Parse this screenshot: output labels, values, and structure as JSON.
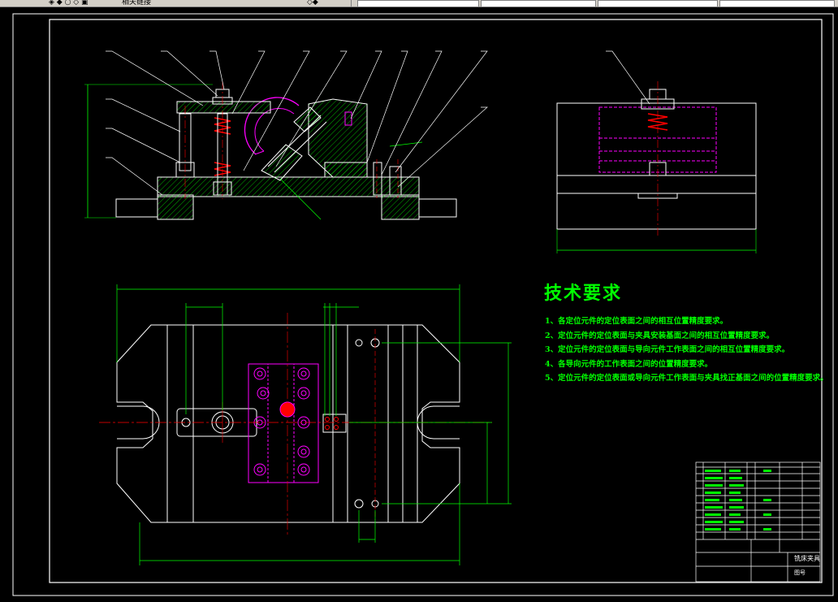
{
  "toolbar": {
    "visible_label": "相关链接"
  },
  "drawing": {
    "title": "技术要求",
    "requirements": [
      "1、各定位元件的定位表面之间的相互位置精度要求。",
      "2、定位元件的定位表面与夹具安装基面之间的相互位置精度要求。",
      "3、定位元件的定位表面与导向元件工作表面之间的相互位置精度要求。",
      "4、各导向元件的工作表面之间的位置精度要求。",
      "5、定位元件的定位表面或导向元件工作表面与夹具找正基面之间的位置精度要求。"
    ],
    "title_block": {
      "name": "铣床夹具",
      "drawing_no": "图号"
    }
  },
  "colors": {
    "background": "#000000",
    "border": "#ffffff",
    "dimension": "#00ff00",
    "hatch": "#00ff00",
    "part_outline": "#ffffff",
    "spring": "#ff0000",
    "workpiece": "#ff00ff",
    "centerline": "#ff0000",
    "text": "#00ff00"
  }
}
